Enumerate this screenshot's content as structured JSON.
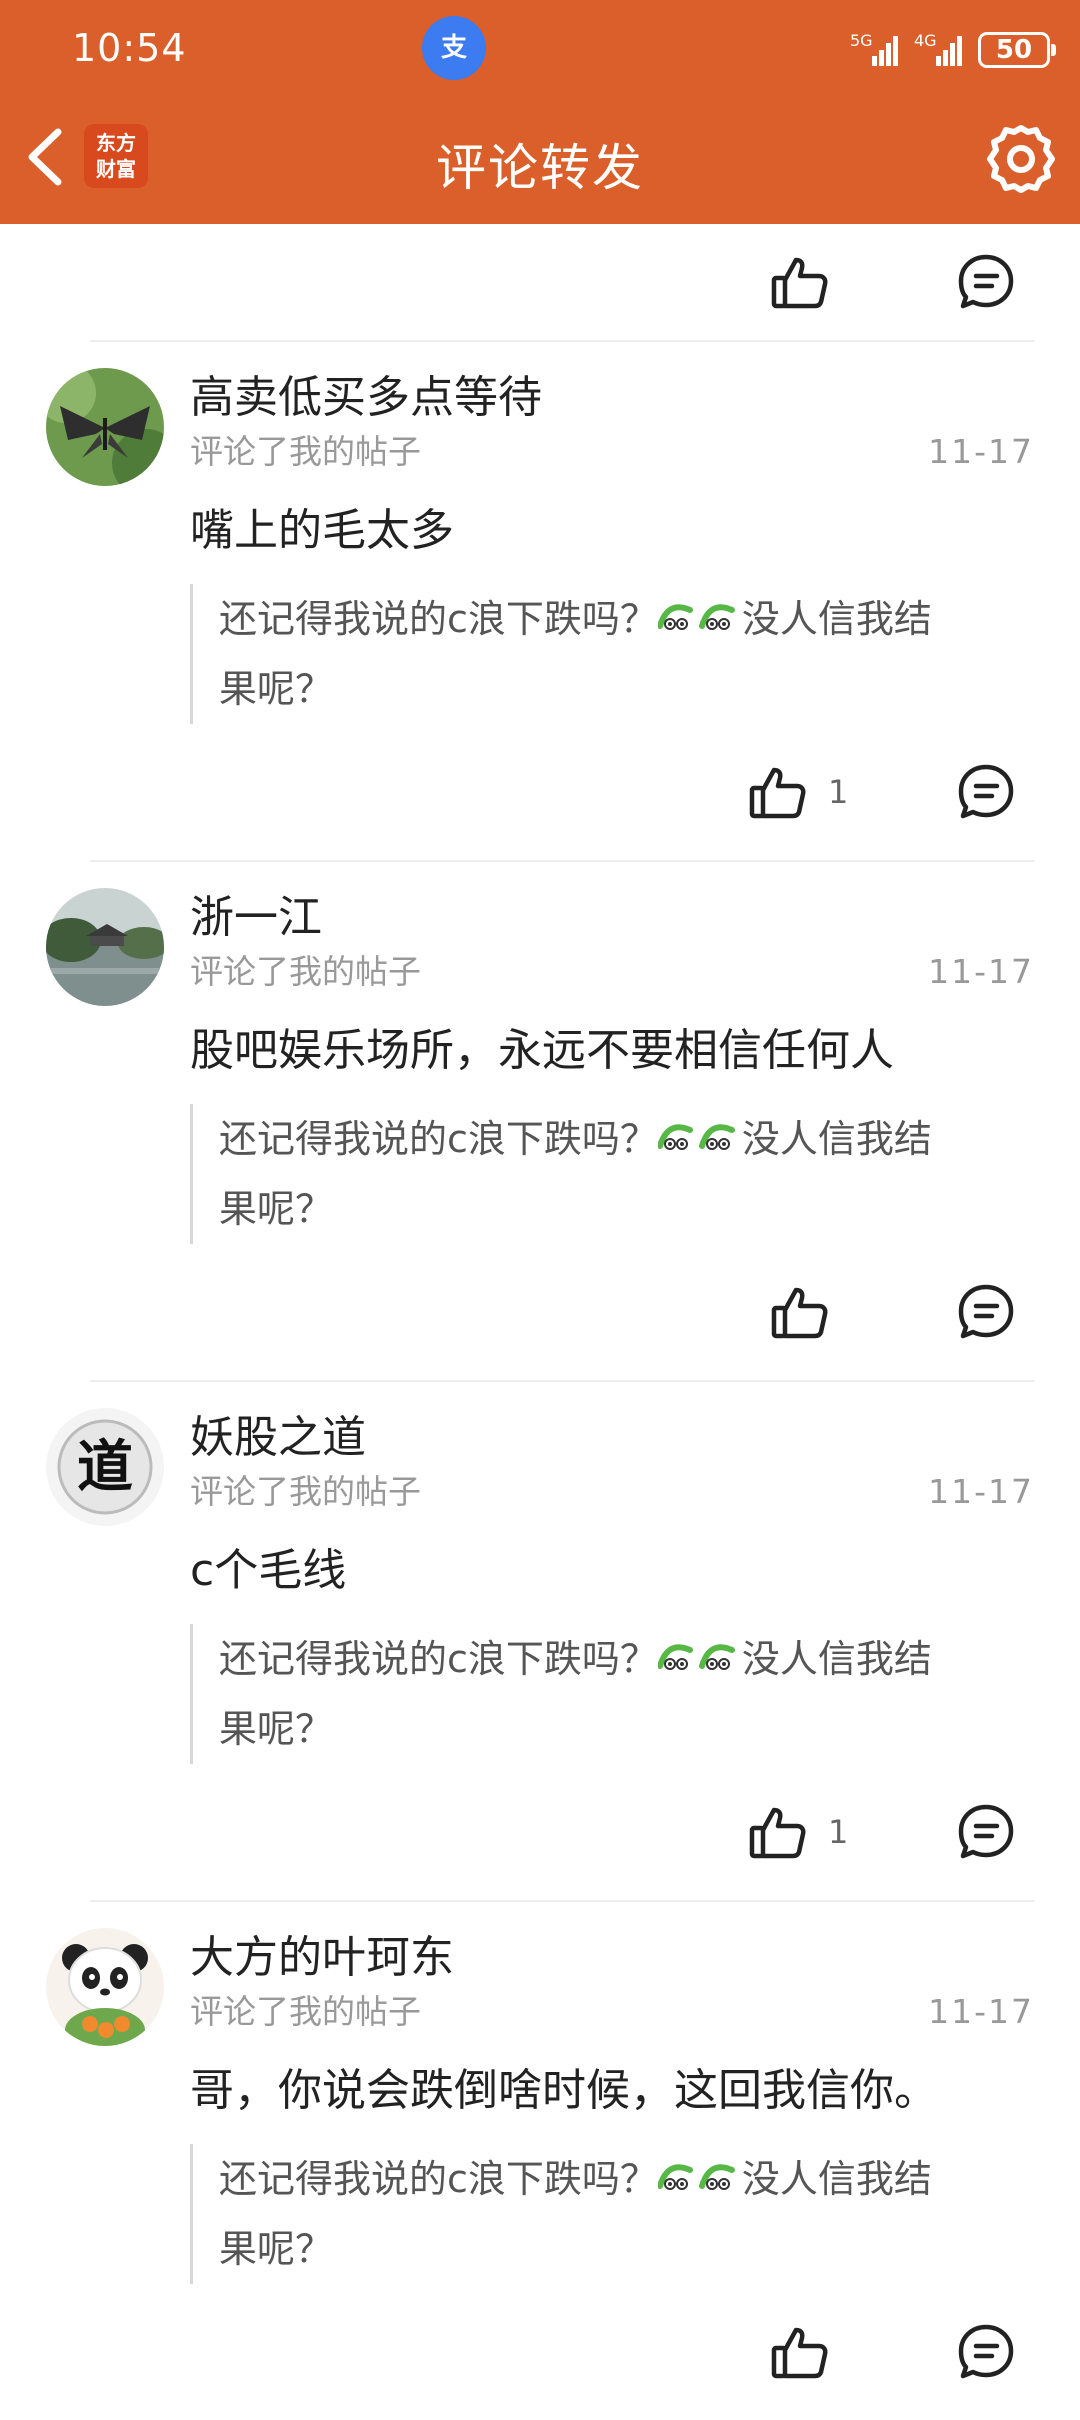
{
  "status_bar": {
    "time": "10:54",
    "alipay_glyph": "支",
    "network_1": "5G",
    "network_2": "4G",
    "battery": "50"
  },
  "header": {
    "title": "评论转发",
    "logo_line1": "东方",
    "logo_line2": "财富",
    "bg_color": "#DA5F2A"
  },
  "icons": {
    "back": "chevron-left-icon",
    "settings": "gear-icon",
    "like": "thumbs-up-icon",
    "comment": "comment-bubble-icon"
  },
  "quote_template": {
    "before": "还记得我说的c浪下跌吗？",
    "after": "没人信我结",
    "line2": "果呢？"
  },
  "items": [
    {
      "name": "高卖低买多点等待",
      "action": "评论了我的帖子",
      "date": "11-17",
      "comment": "嘴上的毛太多",
      "likes": "1"
    },
    {
      "name": "浙一江",
      "action": "评论了我的帖子",
      "date": "11-17",
      "comment": "股吧娱乐场所，永远不要相信任何人",
      "likes": ""
    },
    {
      "name": "妖股之道",
      "action": "评论了我的帖子",
      "date": "11-17",
      "comment": "c个毛线",
      "likes": "1",
      "avatar_glyph": "道"
    },
    {
      "name": "大方的叶珂东",
      "action": "评论了我的帖子",
      "date": "11-17",
      "comment": "哥，你说会跌倒啥时候，这回我信你。",
      "likes": ""
    }
  ]
}
